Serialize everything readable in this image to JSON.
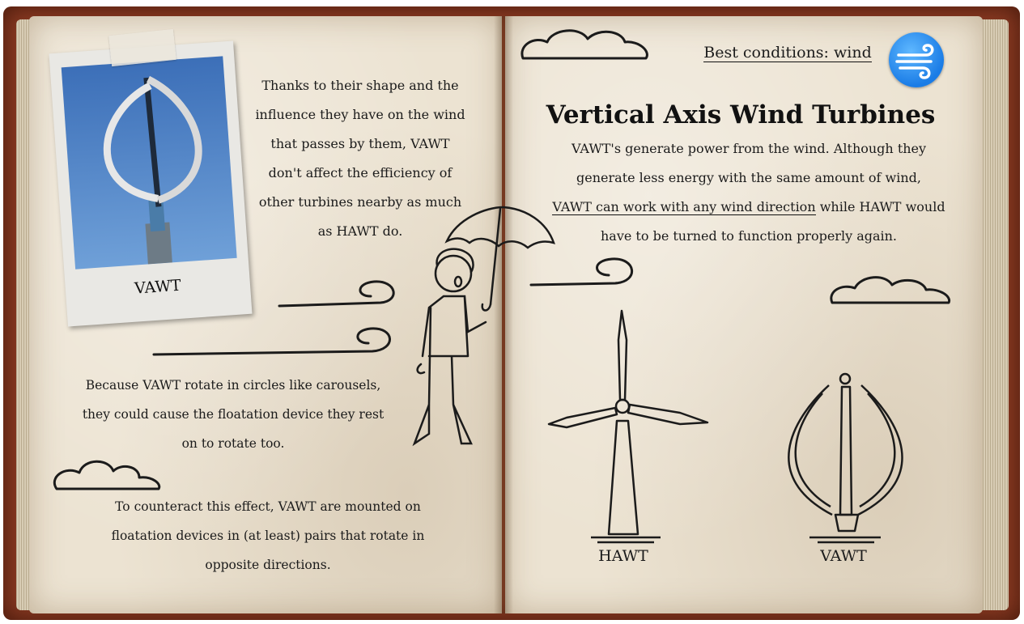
{
  "left_page": {
    "photo_label": "VAWT",
    "paragraph_1": [
      "Thanks to their shape and the",
      "influence they have on the wind",
      "that passes by them, VAWT",
      "don't affect the efficiency of",
      "other turbines nearby as much",
      "as HAWT do."
    ],
    "paragraph_2": [
      "Because VAWT rotate in circles like carousels,",
      "they could cause the floatation device they rest",
      "on to rotate too."
    ],
    "paragraph_3": [
      "To counteract this effect, VAWT are mounted on",
      "floatation devices in (at least) pairs that rotate in",
      "opposite directions."
    ]
  },
  "right_page": {
    "conditions_label": "Best conditions: wind",
    "conditions_icon": "wind-icon",
    "title": "Vertical Axis Wind Turbines",
    "intro_line_1": "VAWT's generate power from the wind. Although they",
    "intro_line_2": "generate less energy with the same amount of wind,",
    "intro_line_3_underlined": "VAWT can work with any wind direction",
    "intro_line_3_rest": " while HAWT would",
    "intro_line_4": "have to be turned to function properly again.",
    "hawt_label": "HAWT",
    "vawt_label": "VAWT"
  },
  "colors": {
    "page": "#ece3d2",
    "cover": "#8a3a22",
    "ink": "#1b1b1b",
    "icon_blue": "#1a7ce6"
  }
}
